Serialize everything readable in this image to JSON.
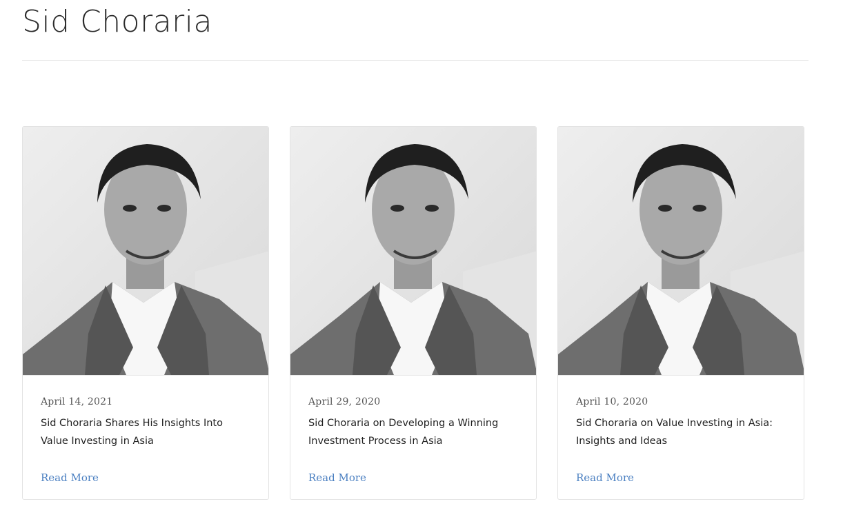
{
  "page": {
    "title": "Sid Choraria"
  },
  "cards": [
    {
      "date": "April 14, 2021",
      "title": "Sid Choraria Shares His Insights Into Value Investing in Asia",
      "link_label": "Read More"
    },
    {
      "date": "April 29, 2020",
      "title": "Sid Choraria on Developing a Winning Investment Process in Asia",
      "link_label": "Read More"
    },
    {
      "date": "April 10, 2020",
      "title": "Sid Choraria on Value Investing in Asia: Insights and Ideas",
      "link_label": "Read More"
    }
  ],
  "colors": {
    "link": "#4a7fc1",
    "divider": "#e6e6e6",
    "card_border": "#e3e3e3"
  },
  "icons": {
    "portrait": "portrait-photo"
  }
}
